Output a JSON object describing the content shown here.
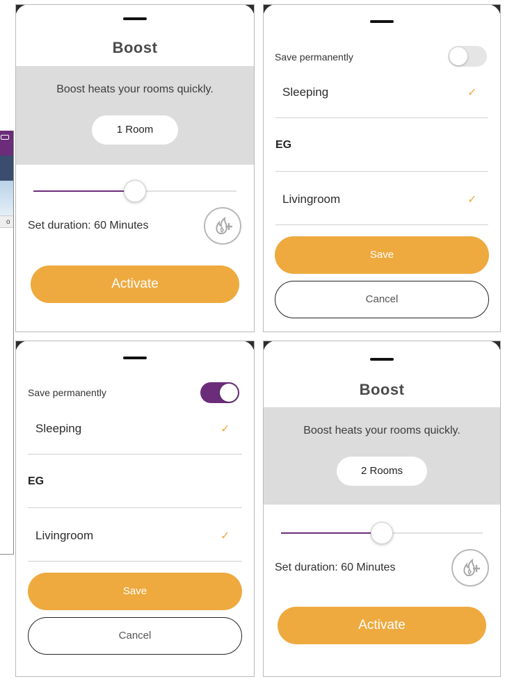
{
  "colors": {
    "accent": "#eeaa3f",
    "purple": "#6b2d7a",
    "band_gray": "#dcdcdc",
    "text_dark": "#2b2b2b"
  },
  "boost_panel_1": {
    "title": "Boost",
    "subtitle": "Boost heats your rooms quickly.",
    "rooms_label": "1 Room",
    "slider_value_fraction": 0.5,
    "duration_label": "Set duration: 60 Minutes",
    "boost_icon": "flame-plus-icon",
    "activate_label": "Activate"
  },
  "rooms_panel_1": {
    "save_permanently_label": "Save permanently",
    "save_permanently_on": false,
    "rooms": [
      {
        "label": "Sleeping",
        "checked": true
      },
      {
        "label": "Livingroom",
        "checked": true
      }
    ],
    "section_label": "EG",
    "check_icon": "checkmark-icon",
    "save_label": "Save",
    "cancel_label": "Cancel"
  },
  "rooms_panel_2": {
    "save_permanently_label": "Save permanently",
    "save_permanently_on": true,
    "rooms": [
      {
        "label": "Sleeping",
        "checked": true
      },
      {
        "label": "Livingroom",
        "checked": true
      }
    ],
    "section_label": "EG",
    "check_icon": "checkmark-icon",
    "save_label": "Save",
    "cancel_label": "Cancel"
  },
  "boost_panel_2": {
    "title": "Boost",
    "subtitle": "Boost heats your rooms quickly.",
    "rooms_label": "2 Rooms",
    "slider_value_fraction": 0.5,
    "duration_label": "Set duration: 60 Minutes",
    "boost_icon": "flame-plus-icon",
    "activate_label": "Activate"
  },
  "background_fragment": {
    "tag_text": "o"
  }
}
